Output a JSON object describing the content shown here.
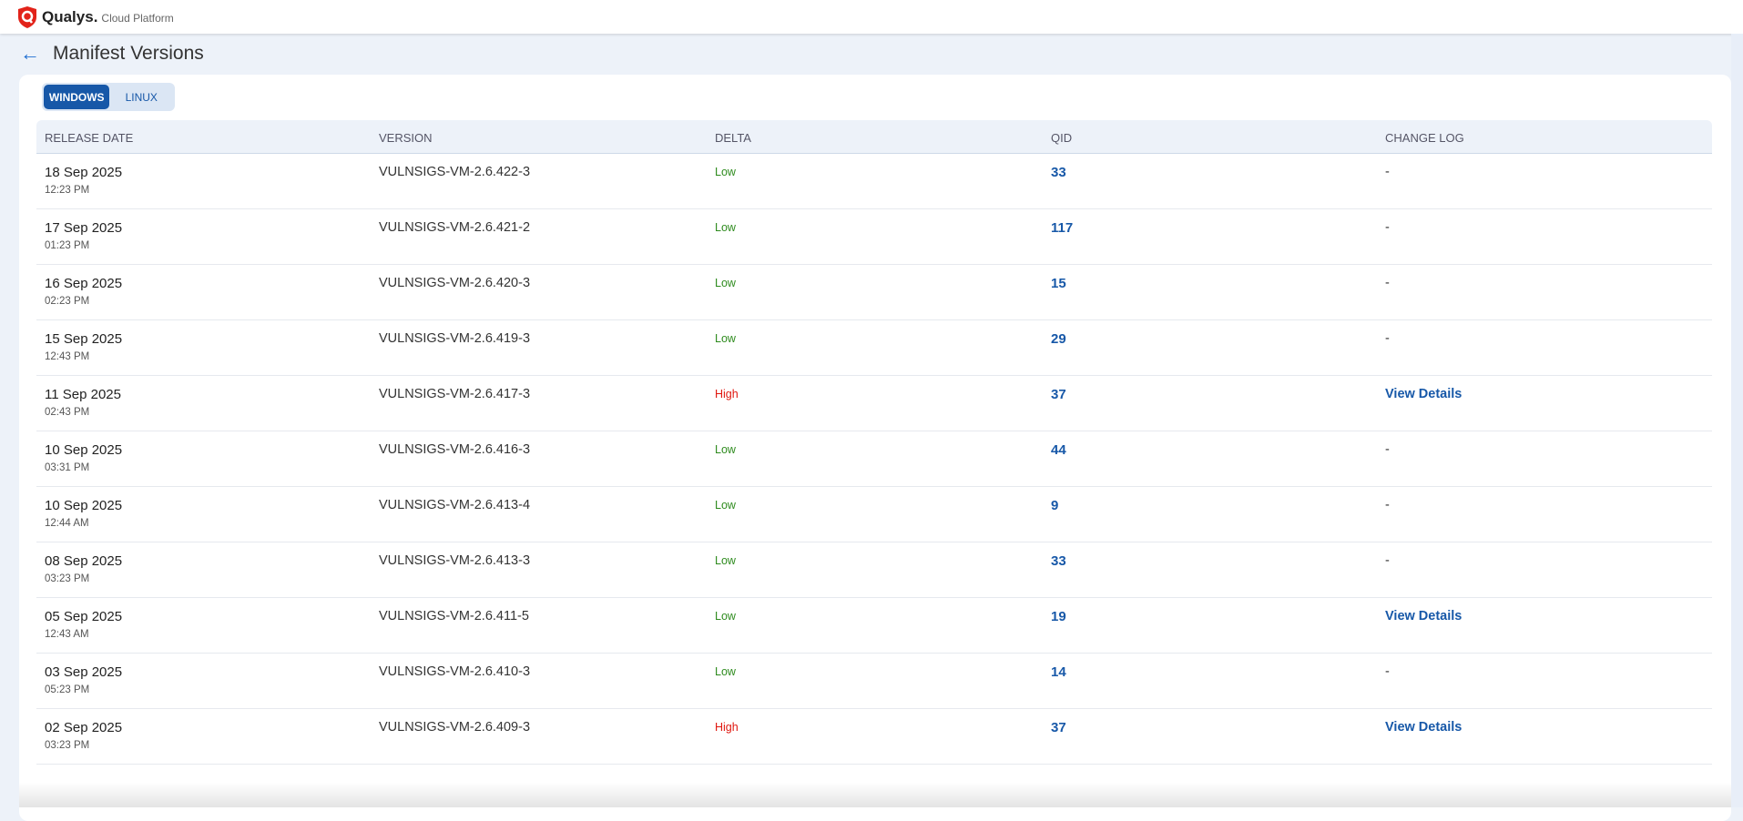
{
  "header": {
    "brand": "Qualys.",
    "subtitle": "Cloud Platform"
  },
  "page": {
    "title": "Manifest Versions"
  },
  "tabs": [
    {
      "label": "WINDOWS",
      "active": true
    },
    {
      "label": "LINUX",
      "active": false
    }
  ],
  "columns": [
    "RELEASE DATE",
    "VERSION",
    "DELTA",
    "QID",
    "CHANGE LOG"
  ],
  "colors": {
    "low": "#2e8b1e",
    "high": "#e0170f",
    "link": "#1758a8"
  },
  "rows": [
    {
      "date": "18 Sep 2025",
      "time": "12:23 PM",
      "version": "VULNSIGS-VM-2.6.422-3",
      "delta": "Low",
      "qid": "33",
      "log": "-"
    },
    {
      "date": "17 Sep 2025",
      "time": "01:23 PM",
      "version": "VULNSIGS-VM-2.6.421-2",
      "delta": "Low",
      "qid": "117",
      "log": "-"
    },
    {
      "date": "16 Sep 2025",
      "time": "02:23 PM",
      "version": "VULNSIGS-VM-2.6.420-3",
      "delta": "Low",
      "qid": "15",
      "log": "-"
    },
    {
      "date": "15 Sep 2025",
      "time": "12:43 PM",
      "version": "VULNSIGS-VM-2.6.419-3",
      "delta": "Low",
      "qid": "29",
      "log": "-"
    },
    {
      "date": "11 Sep 2025",
      "time": "02:43 PM",
      "version": "VULNSIGS-VM-2.6.417-3",
      "delta": "High",
      "qid": "37",
      "log": "View Details"
    },
    {
      "date": "10 Sep 2025",
      "time": "03:31 PM",
      "version": "VULNSIGS-VM-2.6.416-3",
      "delta": "Low",
      "qid": "44",
      "log": "-"
    },
    {
      "date": "10 Sep 2025",
      "time": "12:44 AM",
      "version": "VULNSIGS-VM-2.6.413-4",
      "delta": "Low",
      "qid": "9",
      "log": "-"
    },
    {
      "date": "08 Sep 2025",
      "time": "03:23 PM",
      "version": "VULNSIGS-VM-2.6.413-3",
      "delta": "Low",
      "qid": "33",
      "log": "-"
    },
    {
      "date": "05 Sep 2025",
      "time": "12:43 AM",
      "version": "VULNSIGS-VM-2.6.411-5",
      "delta": "Low",
      "qid": "19",
      "log": "View Details"
    },
    {
      "date": "03 Sep 2025",
      "time": "05:23 PM",
      "version": "VULNSIGS-VM-2.6.410-3",
      "delta": "Low",
      "qid": "14",
      "log": "-"
    },
    {
      "date": "02 Sep 2025",
      "time": "03:23 PM",
      "version": "VULNSIGS-VM-2.6.409-3",
      "delta": "High",
      "qid": "37",
      "log": "View Details"
    }
  ]
}
